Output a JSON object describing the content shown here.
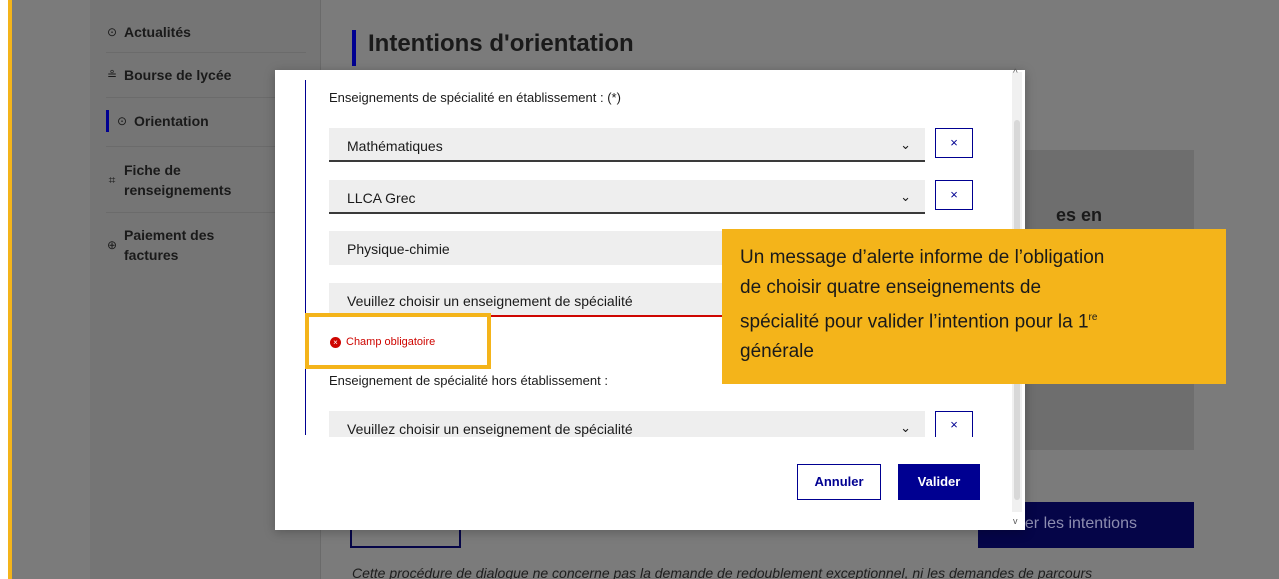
{
  "sidebar": {
    "items": [
      {
        "icon": "clock-icon",
        "glyph": "⊙",
        "label": "Actualités"
      },
      {
        "icon": "scholarship-icon",
        "glyph": "≗",
        "label": "Bourse de lycée"
      },
      {
        "icon": "compass-icon",
        "glyph": "⊙",
        "label": "Orientation"
      },
      {
        "icon": "form-icon",
        "glyph": "⌗",
        "label_line1": "Fiche de",
        "label_line2": "renseignements"
      },
      {
        "icon": "payment-icon",
        "glyph": "⊕",
        "label_line1": "Paiement des",
        "label_line2": "factures"
      }
    ],
    "active": "Orientation"
  },
  "page": {
    "title": "Intentions d'orientation",
    "partial_heading": "es en",
    "submit_partial": "der les intentions",
    "footer_text": "Cette procédure de dialogue ne concerne pas la demande de redoublement exceptionnel, ni les demandes de parcours"
  },
  "modal": {
    "section1_label": "Enseignements de spécialité en établissement : (*)",
    "selects": [
      {
        "value": "Mathématiques"
      },
      {
        "value": "LLCA Grec"
      },
      {
        "value": "Physique-chimie"
      },
      {
        "value": "Veuillez choisir un enseignement de spécialité"
      }
    ],
    "remove_glyph": "×",
    "chevron_glyph": "⌄",
    "error_text": "Champ obligatoire",
    "section2_label": "Enseignement de spécialité hors établissement :",
    "select_outside": {
      "value": "Veuillez choisir un enseignement de spécialité"
    },
    "cancel_label": "Annuler",
    "confirm_label": "Valider"
  },
  "callout": {
    "text_line1": "Un message d’alerte informe de l’obligation",
    "text_line2": "de choisir quatre enseignements de",
    "text_line3": "spécialité pour valider l’intention pour la 1",
    "text_sup": "re",
    "text_line4": "générale"
  },
  "colors": {
    "accent_blue": "#000091",
    "error_red": "#ce0500",
    "highlight_yellow": "#f4b41a",
    "overlay_gray": "#7b7b7b"
  }
}
